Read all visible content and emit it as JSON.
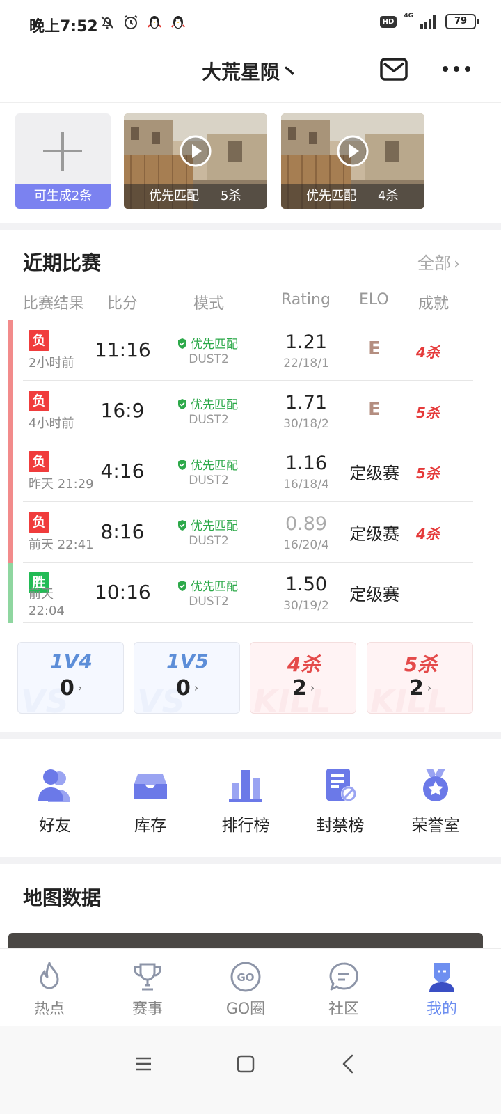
{
  "status_bar": {
    "time": "晚上7:52",
    "hd": "HD",
    "network": "4G",
    "battery": "79"
  },
  "header": {
    "title": "大荒星陨丶"
  },
  "videos": {
    "generate_label": "可生成2条",
    "items": [
      {
        "mode": "优先匹配",
        "kills": "5杀"
      },
      {
        "mode": "优先匹配",
        "kills": "4杀"
      }
    ]
  },
  "recent_matches": {
    "title": "近期比赛",
    "all_link": "全部",
    "columns": [
      "比赛结果",
      "比分",
      "模式",
      "Rating",
      "ELO",
      "成就"
    ],
    "rows": [
      {
        "result": "负",
        "outcome": "lose",
        "time": "2小时前",
        "score": "11:16",
        "mode": "优先匹配",
        "map": "DUST2",
        "rating": "1.21",
        "kda": "22/18/1",
        "elo": "E",
        "achievement": "4杀"
      },
      {
        "result": "负",
        "outcome": "lose",
        "time": "4小时前",
        "score": "16:9",
        "mode": "优先匹配",
        "map": "DUST2",
        "rating": "1.71",
        "kda": "30/18/2",
        "elo": "E",
        "achievement": "5杀"
      },
      {
        "result": "负",
        "outcome": "lose",
        "time": "昨天 21:29",
        "score": "4:16",
        "mode": "优先匹配",
        "map": "DUST2",
        "rating": "1.16",
        "kda": "16/18/4",
        "elo": "定级赛",
        "achievement": "5杀"
      },
      {
        "result": "负",
        "outcome": "lose",
        "time": "前天 22:41",
        "score": "8:16",
        "mode": "优先匹配",
        "map": "DUST2",
        "rating": "0.89",
        "kda": "16/20/4",
        "elo": "定级赛",
        "achievement": "4杀"
      },
      {
        "result": "胜",
        "outcome": "win",
        "time": "前天 22:04",
        "score": "10:16",
        "mode": "优先匹配",
        "map": "DUST2",
        "rating": "1.50",
        "kda": "30/19/2",
        "elo": "定级赛",
        "achievement": ""
      }
    ]
  },
  "stats": [
    {
      "label": "1V4",
      "value": "0",
      "watermark": "VS",
      "tone": "blue"
    },
    {
      "label": "1V5",
      "value": "0",
      "watermark": "VS",
      "tone": "blue"
    },
    {
      "label": "4杀",
      "value": "2",
      "watermark": "KILL",
      "tone": "red"
    },
    {
      "label": "5杀",
      "value": "2",
      "watermark": "KILL",
      "tone": "red"
    }
  ],
  "quick_menu": [
    "好友",
    "库存",
    "排行榜",
    "封禁榜",
    "荣誉室"
  ],
  "map_section": {
    "title": "地图数据"
  },
  "bottom_nav": [
    {
      "label": "热点",
      "icon": "flame-icon",
      "active": false
    },
    {
      "label": "赛事",
      "icon": "trophy-icon",
      "active": false
    },
    {
      "label": "GO圈",
      "icon": "go-circle-icon",
      "active": false
    },
    {
      "label": "社区",
      "icon": "chat-icon",
      "active": false
    },
    {
      "label": "我的",
      "icon": "profile-icon",
      "active": true
    }
  ],
  "colors": {
    "accent": "#6e8ff0",
    "lose": "#f03c3c",
    "win": "#22bb55",
    "mode_green": "#2da94a",
    "kill_red": "#e53a3a",
    "generate_purple": "#7b82f0"
  }
}
